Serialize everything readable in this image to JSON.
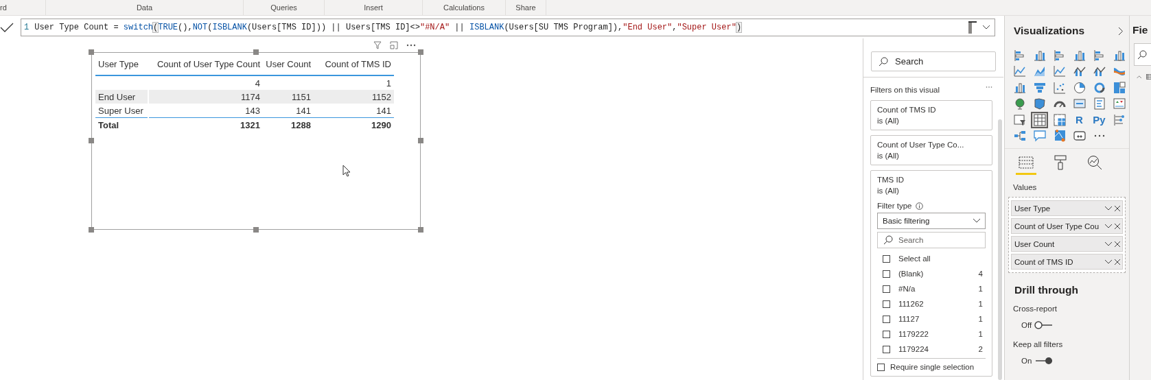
{
  "ribbon_groups": [
    "rd",
    "Data",
    "Queries",
    "Insert",
    "Calculations",
    "Share"
  ],
  "formula": {
    "line_number": "1",
    "tokens": [
      {
        "kind": "plain",
        "text": "User Type Count = "
      },
      {
        "kind": "function",
        "text": "switch"
      },
      {
        "kind": "bracket",
        "text": "("
      },
      {
        "kind": "function",
        "text": "TRUE"
      },
      {
        "kind": "plain",
        "text": "(),"
      },
      {
        "kind": "function",
        "text": "NOT"
      },
      {
        "kind": "plain",
        "text": "("
      },
      {
        "kind": "function",
        "text": "ISBLANK"
      },
      {
        "kind": "plain",
        "text": "(Users[TMS ID])) || Users[TMS ID]<>"
      },
      {
        "kind": "string",
        "text": "\"#N/A\""
      },
      {
        "kind": "plain",
        "text": " || "
      },
      {
        "kind": "function",
        "text": "ISBLANK"
      },
      {
        "kind": "plain",
        "text": "(Users[SU TMS Program]),"
      },
      {
        "kind": "string",
        "text": "\"End User\""
      },
      {
        "kind": "plain",
        "text": ","
      },
      {
        "kind": "string",
        "text": "\"Super User\""
      },
      {
        "kind": "bracket",
        "text": ")"
      }
    ]
  },
  "table": {
    "columns": [
      "User Type",
      "Count of User Type Count",
      "User Count",
      "Count of TMS ID"
    ],
    "rows": [
      {
        "cells": [
          null,
          "4",
          null,
          "1"
        ],
        "highlighted": false
      },
      {
        "cells": [
          "End User",
          "1174",
          "1151",
          "1152"
        ],
        "highlighted": true
      },
      {
        "cells": [
          "Super User",
          "143",
          "141",
          "141"
        ],
        "highlighted": false
      }
    ],
    "total": [
      "Total",
      "1321",
      "1288",
      "1290"
    ]
  },
  "filters": {
    "search_placeholder": "Search",
    "section_title": "Filters on this visual",
    "cards": [
      {
        "title": "Count of TMS ID",
        "summary": "is (All)",
        "expanded": false
      },
      {
        "title": "Count of User Type Co...",
        "summary": "is (All)",
        "expanded": false
      },
      {
        "title": "TMS ID",
        "summary": "is (All)",
        "expanded": true,
        "filter_type_label": "Filter type",
        "filter_type_value": "Basic filtering",
        "list_search_placeholder": "Search",
        "values": [
          {
            "label": "Select all",
            "checked": false
          },
          {
            "label": "(Blank)",
            "count": "4",
            "checked": false
          },
          {
            "label": "#N/a",
            "count": "1",
            "checked": false
          },
          {
            "label": "111262",
            "count": "1",
            "checked": false
          },
          {
            "label": "11127",
            "count": "1",
            "checked": false
          },
          {
            "label": "1179222",
            "count": "1",
            "checked": false
          },
          {
            "label": "1179224",
            "count": "2",
            "checked": false
          }
        ],
        "require_single": {
          "label": "Require single selection",
          "checked": false
        }
      }
    ]
  },
  "visualizations": {
    "title": "Visualizations",
    "gallery": [
      {
        "selected": false
      },
      {
        "selected": false
      },
      {
        "selected": false
      },
      {
        "selected": false
      },
      {
        "selected": false
      },
      {
        "selected": false
      },
      {
        "selected": false
      },
      {
        "selected": false
      },
      {
        "selected": false
      },
      {
        "selected": false
      },
      {
        "selected": false
      },
      {
        "selected": false
      },
      {
        "selected": false
      },
      {
        "selected": false
      },
      {
        "selected": false
      },
      {
        "selected": false
      },
      {
        "selected": false
      },
      {
        "selected": false
      },
      {
        "selected": false
      },
      {
        "selected": false
      },
      {
        "selected": false
      },
      {
        "selected": false
      },
      {
        "selected": false
      },
      {
        "selected": false
      },
      {
        "selected": false
      },
      {
        "selected": true
      },
      {
        "selected": false
      },
      {
        "label": "R",
        "selected": false
      },
      {
        "label": "Py",
        "selected": false
      },
      {
        "selected": false
      },
      {
        "selected": false
      },
      {
        "selected": false
      },
      {
        "selected": false
      },
      {
        "selected": false
      }
    ],
    "pane_tabs": [
      {
        "selected": true
      },
      {
        "selected": false
      },
      {
        "selected": false
      }
    ],
    "wells_label": "Values",
    "wells": [
      "User Type",
      "Count of User Type Cou",
      "User Count",
      "Count of TMS ID"
    ],
    "drill_title": "Drill through",
    "toggles": [
      {
        "label": "Cross-report",
        "state_text": "Off",
        "on": false
      },
      {
        "label": "Keep all filters",
        "state_text": "On",
        "on": true
      }
    ]
  },
  "fields": {
    "title": "Fie"
  }
}
